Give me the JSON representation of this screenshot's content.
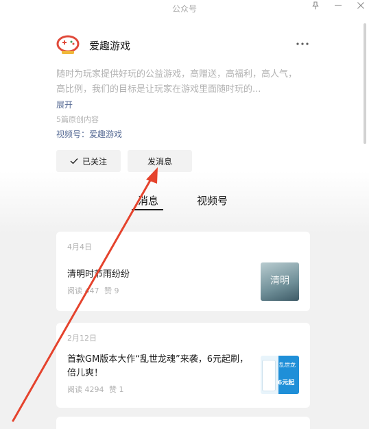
{
  "window": {
    "title": "公众号"
  },
  "account": {
    "name": "爱趣游戏",
    "description": "随时为玩家提供好玩的公益游戏，高赠送，高福利，高人气，高比例，我们的目标是让玩家在游戏里面随时玩的...",
    "expand_label": "展开",
    "original_count": "5篇原创内容",
    "channels_label": "视频号：爱趣游戏"
  },
  "actions": {
    "followed_label": "已关注",
    "message_label": "发消息"
  },
  "tabs": [
    {
      "label": "消息",
      "selected": true
    },
    {
      "label": "视频号",
      "selected": false
    }
  ],
  "articles": [
    {
      "date": "4月4日",
      "title": "清明时节雨纷纷",
      "reads_label": "阅读",
      "reads": "447",
      "likes_label": "赞",
      "likes": "9",
      "thumb_text": "清明"
    },
    {
      "date": "2月12日",
      "title": "首款GM版本大作“乱世龙魂”来袭，6元起刷，倍儿爽！",
      "reads_label": "阅读",
      "reads": "4294",
      "likes_label": "赞",
      "likes": "1",
      "thumb_text": "乱世龙",
      "thumb_badge": "6元起"
    }
  ],
  "colors": {
    "link": "#576b95",
    "muted": "#b2b2b2",
    "arrow": "#e5432d",
    "primary_text": "#191919"
  },
  "icons": [
    "pin-icon",
    "minimize-icon",
    "close-icon",
    "more-icon",
    "check-icon",
    "logo"
  ]
}
